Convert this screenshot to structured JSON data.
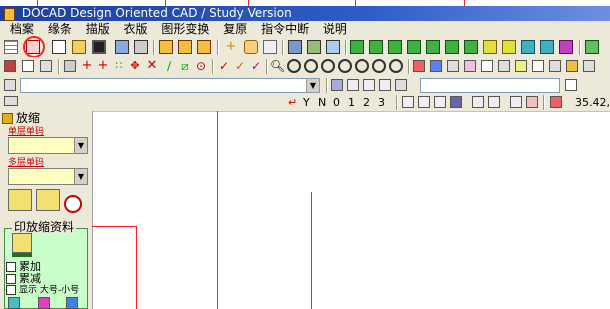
{
  "window": {
    "title": "DOCAD Design Oriented CAD / Study Version"
  },
  "menu": [
    "档案",
    "缘条",
    "描版",
    "衣版",
    "图形变换",
    "复原",
    "指令中断",
    "说明"
  ],
  "toolbar": {
    "coord_readout": "35.42,",
    "icon_names": [
      "grid-icon",
      "save-icon",
      "print-icon",
      "layers-icon",
      "draw-icon",
      "zoom-icon",
      "piece-icon"
    ]
  },
  "panel": {
    "title": "放缩",
    "field1_label": "单层单码",
    "field2_label": "多层单码",
    "group_title": "印放缩资料",
    "checkboxes": [
      "累加",
      "累减",
      "显示 大号-小号"
    ],
    "colors": {
      "field_bg": "#ffffc0",
      "group_bg": "#c8ffc8",
      "label_red": "#d00000"
    }
  }
}
